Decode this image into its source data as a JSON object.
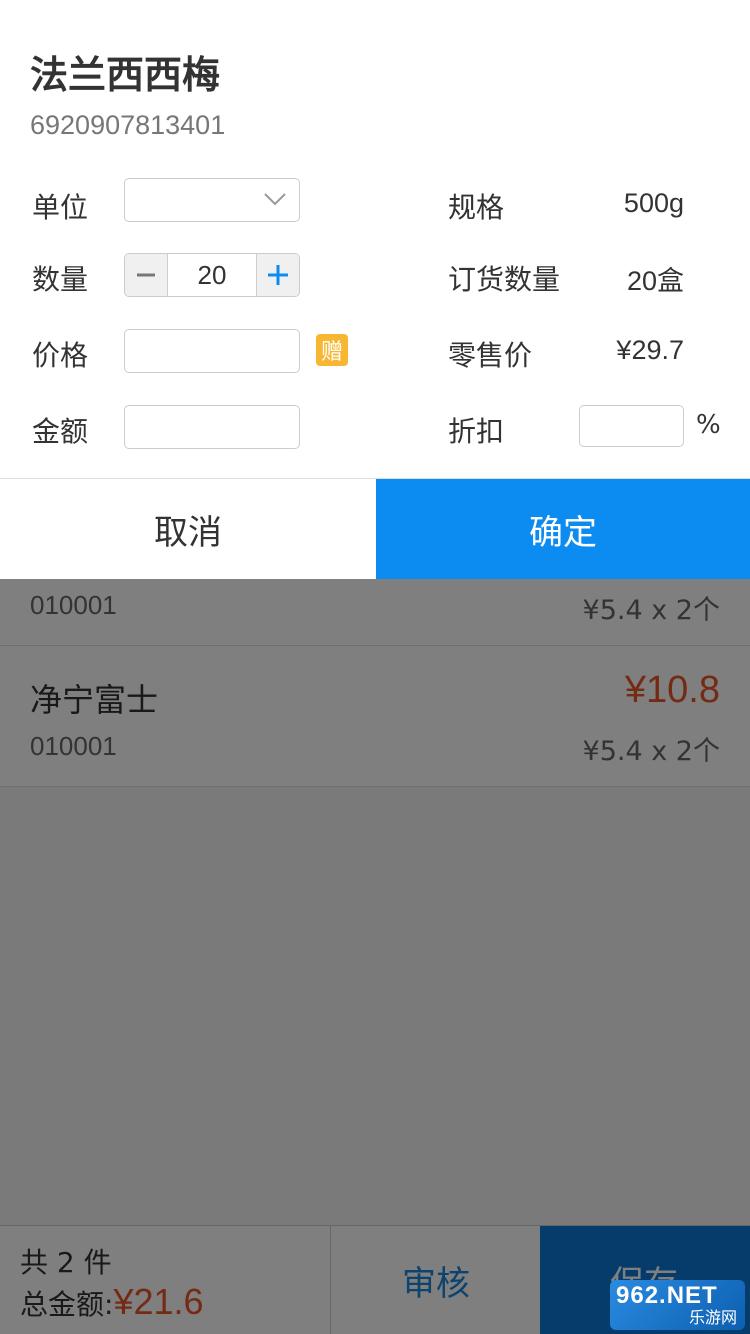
{
  "background": {
    "items": [
      {
        "name": "",
        "code": "010001",
        "unit_price": "¥5.4 x 2个",
        "total": ""
      },
      {
        "name": "净宁富士",
        "code": "010001",
        "unit_price": "¥5.4 x 2个",
        "total": "¥10.8"
      }
    ],
    "footer": {
      "count_text": "共 2 件",
      "amount_label": "总金额:",
      "amount_value": "¥21.6",
      "audit_label": "审核",
      "save_label": "保存"
    },
    "watermark": {
      "top": "962.NET",
      "bottom": "乐游网"
    }
  },
  "modal": {
    "product_name": "法兰西西梅",
    "barcode": "6920907813401",
    "unit": {
      "label": "单位",
      "value": ""
    },
    "spec": {
      "label": "规格",
      "value": "500g"
    },
    "quantity": {
      "label": "数量",
      "value": "20"
    },
    "order_qty": {
      "label": "订货数量",
      "value": "20盒"
    },
    "price": {
      "label": "价格",
      "value": "",
      "gift_badge": "赠"
    },
    "retail_price": {
      "label": "零售价",
      "value": "¥29.7"
    },
    "amount": {
      "label": "金额",
      "value": ""
    },
    "discount": {
      "label": "折扣",
      "value": "",
      "unit": "%"
    },
    "cancel_label": "取消",
    "confirm_label": "确定"
  },
  "colors": {
    "accent": "#0c8cf0",
    "price_red": "#e8562a",
    "gift_yellow": "#f7b733"
  }
}
